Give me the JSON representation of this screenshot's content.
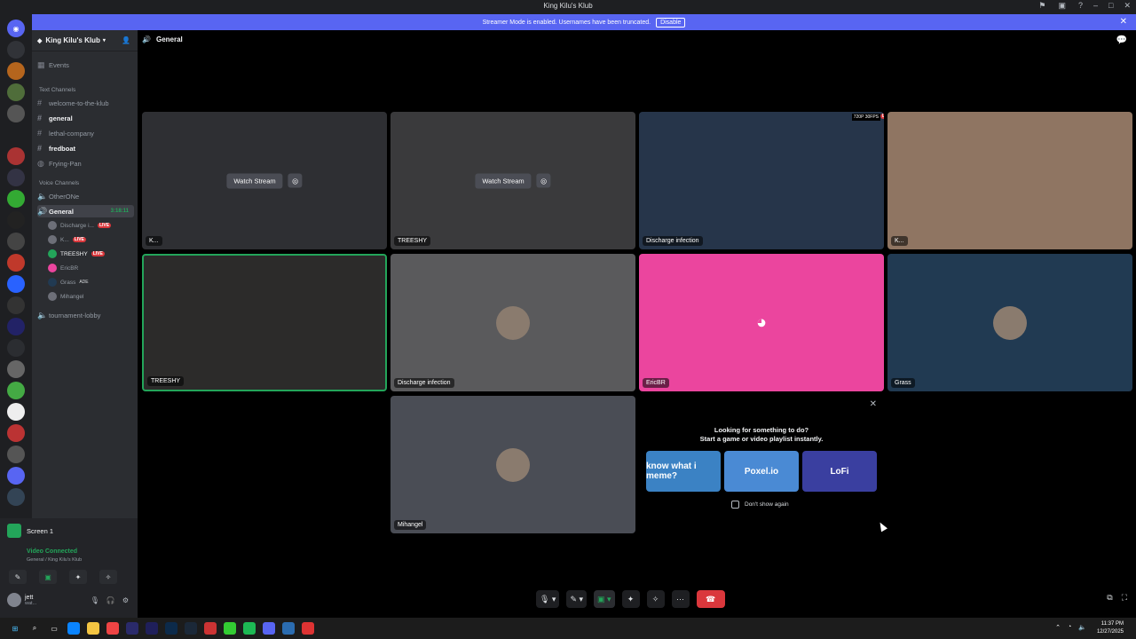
{
  "window": {
    "title": "King Kilu's Klub"
  },
  "banner": {
    "text": "Streamer Mode is enabled. Usernames have been truncated.",
    "button": "Disable"
  },
  "server": {
    "name": "King Kilu's Klub"
  },
  "sidebar": {
    "events": "Events",
    "text_category": "Text Channels",
    "text_channels": [
      "welcome-to-the-klub",
      "general",
      "lethal-company",
      "fredboat",
      "Frying-Pan"
    ],
    "voice_category": "Voice Channels",
    "voice_channels": [
      "OtherONe",
      "General",
      "tournament-lobby"
    ],
    "general_timer": "3:18:11",
    "live_badge": "LIVE",
    "voice_users": [
      {
        "name": "Discharge i...",
        "live": true
      },
      {
        "name": "K...",
        "live": true
      },
      {
        "name": "TREESHY",
        "live": true
      },
      {
        "name": "EricBR",
        "live": false
      },
      {
        "name": "Grass",
        "live": false,
        "tag": "ADE"
      },
      {
        "name": "Mihangel",
        "live": false
      }
    ]
  },
  "user_panel": {
    "screen_label": "Screen 1",
    "status": "Video Connected",
    "location": "General / King Kilu's Klub",
    "username": "jett",
    "substatus": "wat..."
  },
  "stage": {
    "channel": "General",
    "watch_label": "Watch Stream",
    "tiles": [
      {
        "name": "K...",
        "kind": "stream",
        "color": "#2e2f33"
      },
      {
        "name": "TREESHY",
        "kind": "stream",
        "color": "#3a3a3c"
      },
      {
        "name": "Discharge infection",
        "kind": "stream-live",
        "color": "#26354a"
      },
      {
        "name": "K...",
        "kind": "webcam",
        "color": "#8f7562"
      },
      {
        "name": "TREESHY",
        "kind": "webcam",
        "color": "#2c2b2a"
      },
      {
        "name": "Discharge infection",
        "kind": "avatar",
        "color": "#5a5a5c"
      },
      {
        "name": "EricBR",
        "kind": "discord",
        "color": "#eb459e"
      },
      {
        "name": "Grass",
        "kind": "avatar",
        "color": "#213a52"
      },
      {
        "name": "Mihangel",
        "kind": "avatar",
        "color": "#4a4d55"
      }
    ],
    "stream_badge": "720P 30FPS",
    "live_badge": "LIVE"
  },
  "activity": {
    "line1": "Looking for something to do?",
    "line2": "Start a game or video playlist instantly.",
    "items": [
      {
        "name": "know what i meme?",
        "color": "#3b82c4"
      },
      {
        "name": "Poxel.io",
        "color": "#4a8ad4"
      },
      {
        "name": "LoFi",
        "color": "#3a3fa0"
      }
    ],
    "dont_show": "Don't show again"
  },
  "taskbar": {
    "time": "11:37 PM",
    "date": "12/27/2025"
  }
}
